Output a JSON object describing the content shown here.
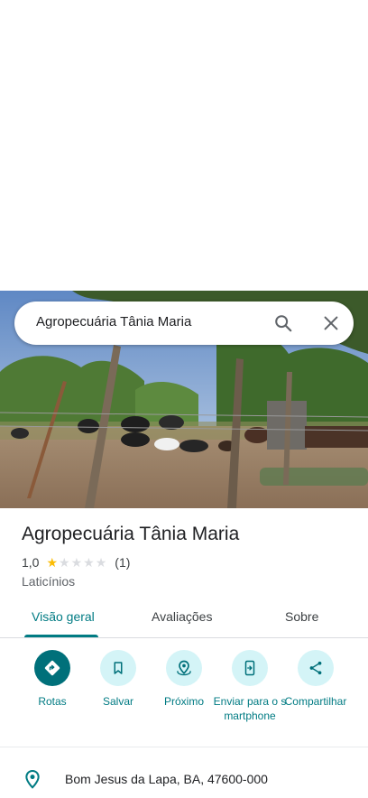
{
  "search": {
    "query": "Agropecuária Tânia Maria"
  },
  "place": {
    "name": "Agropecuária Tânia Maria",
    "rating": "1,0",
    "stars": 1,
    "review_count": "(1)",
    "category": "Laticínios"
  },
  "tabs": [
    {
      "label": "Visão geral",
      "active": true
    },
    {
      "label": "Avaliações",
      "active": false
    },
    {
      "label": "Sobre",
      "active": false
    }
  ],
  "actions": [
    {
      "label": "Rotas",
      "icon": "directions-icon"
    },
    {
      "label": "Salvar",
      "icon": "bookmark-icon"
    },
    {
      "label": "Próximo",
      "icon": "nearby-icon"
    },
    {
      "label": "Enviar para o smartphone",
      "icon": "send-to-phone-icon"
    },
    {
      "label": "Compartilhar",
      "icon": "share-icon"
    }
  ],
  "address": "Bom Jesus da Lapa, BA, 47600-000",
  "colors": {
    "accent": "#007b83",
    "accent_light": "#d4f4f7",
    "primary_button": "#00707a",
    "star": "#fbbc04"
  }
}
